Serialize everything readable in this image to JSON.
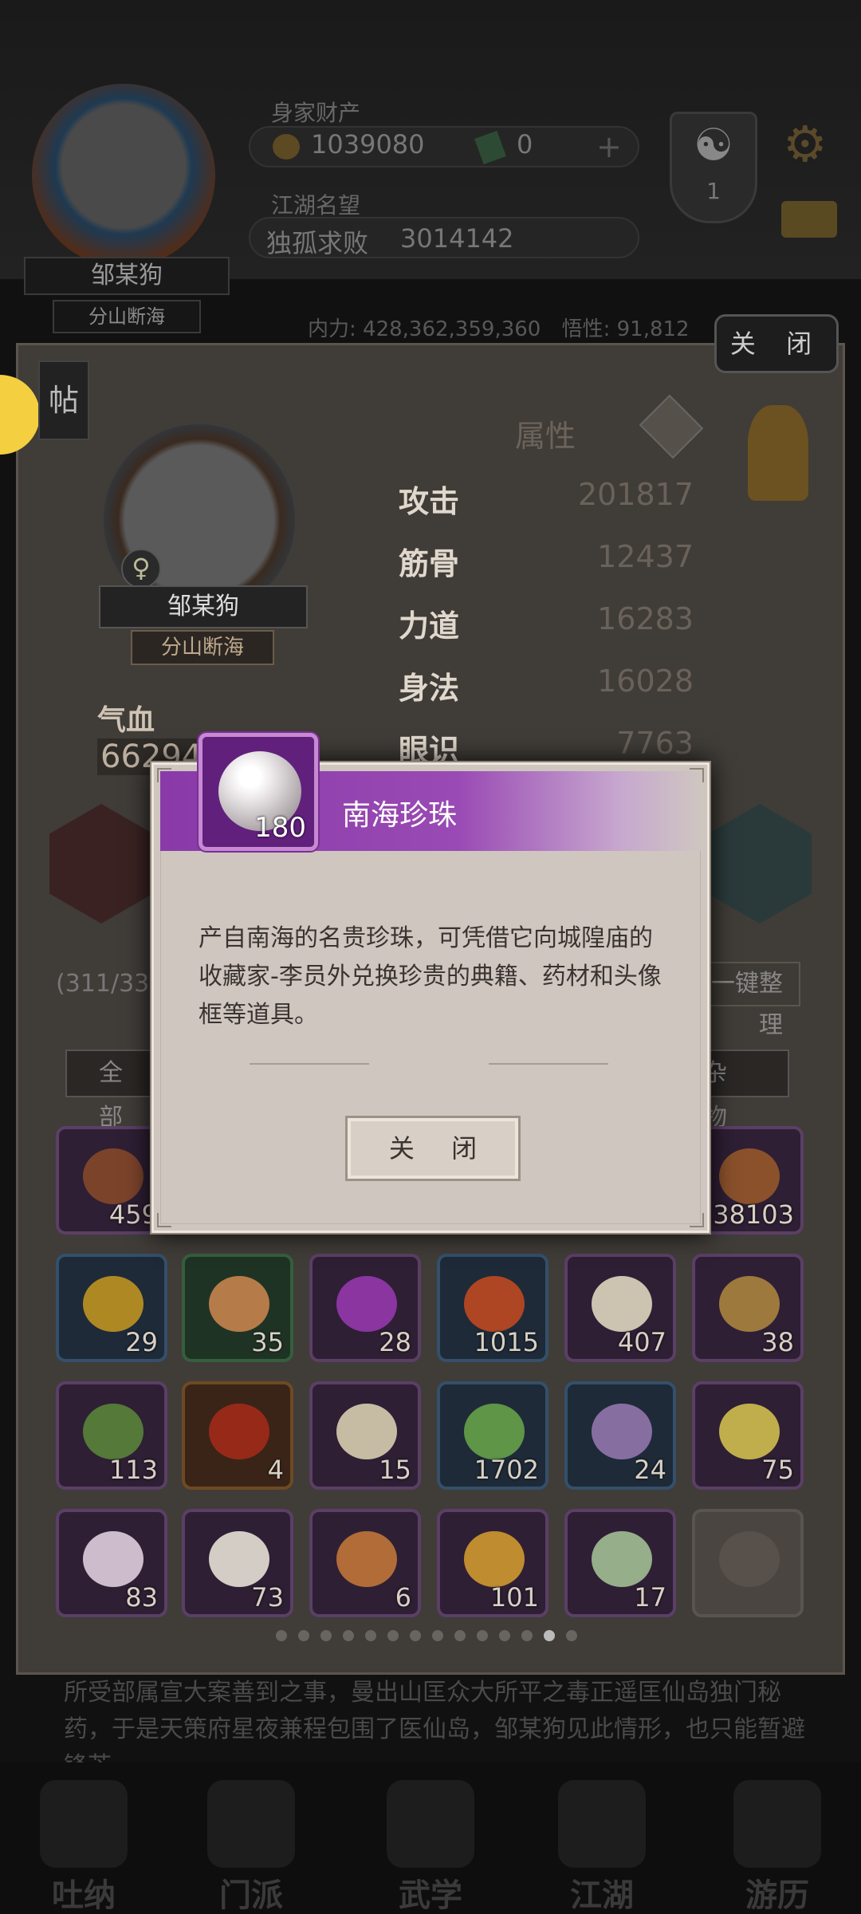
{
  "header": {
    "wealth_label": "身家财产",
    "coins": "1039080",
    "jade": "0",
    "plus": "+",
    "fame_label": "江湖名望",
    "fame_title": "独孤求败",
    "fame_value": "3014142",
    "rank_number": "1",
    "rank_symbol": "☯",
    "player_name": "邹某狗",
    "player_title": "分山断海",
    "power_label": "内力: 428,362,359,360",
    "insight_label": "悟性: 91,812"
  },
  "panel": {
    "close_label": "关 闭",
    "post_label": "帖",
    "gender_symbol": "♀",
    "char_name": "邹某狗",
    "char_title": "分山断海",
    "blood_label": "气血",
    "blood_value": "66294",
    "attr_title": "属性",
    "attributes": [
      {
        "name": "攻击",
        "value": "201817"
      },
      {
        "name": "筋骨",
        "value": "12437"
      },
      {
        "name": "力道",
        "value": "16283"
      },
      {
        "name": "身法",
        "value": "16028"
      },
      {
        "name": "眼识",
        "value": "7763"
      }
    ],
    "bag_count": "(311/336",
    "sort_label": "一键整理",
    "filter_all": "全 部",
    "filter_misc": "杂 物"
  },
  "items": [
    {
      "count": "459",
      "quality": "purple",
      "color": "#8a4a2a"
    },
    {
      "count": "",
      "quality": "purple",
      "color": "#5a4a6a"
    },
    {
      "count": "",
      "quality": "purple",
      "color": "#5a4a6a"
    },
    {
      "count": "",
      "quality": "purple",
      "color": "#5a4a6a"
    },
    {
      "count": "",
      "quality": "purple",
      "color": "#5a4a6a"
    },
    {
      "count": "38103",
      "quality": "purple",
      "color": "#9a5a2a"
    },
    {
      "count": "29",
      "quality": "blue",
      "color": "#c89a20"
    },
    {
      "count": "35",
      "quality": "green",
      "color": "#d08a50"
    },
    {
      "count": "28",
      "quality": "purple",
      "color": "#9a3ab4"
    },
    {
      "count": "1015",
      "quality": "blue",
      "color": "#c84a20"
    },
    {
      "count": "407",
      "quality": "purple",
      "color": "#e8e0c8"
    },
    {
      "count": "38",
      "quality": "purple",
      "color": "#b08a40"
    },
    {
      "count": "113",
      "quality": "purple",
      "color": "#5a8a3a"
    },
    {
      "count": "4",
      "quality": "orange",
      "color": "#a82a1a"
    },
    {
      "count": "15",
      "quality": "purple",
      "color": "#e0d8b8"
    },
    {
      "count": "1702",
      "quality": "blue",
      "color": "#6aa84a"
    },
    {
      "count": "24",
      "quality": "blue",
      "color": "#9a7ab4"
    },
    {
      "count": "75",
      "quality": "purple",
      "color": "#d8c850"
    },
    {
      "count": "83",
      "quality": "purple",
      "color": "#e8d8e8"
    },
    {
      "count": "73",
      "quality": "purple",
      "color": "#f0ece0"
    },
    {
      "count": "6",
      "quality": "purple",
      "color": "#c87a3a"
    },
    {
      "count": "101",
      "quality": "purple",
      "color": "#d8a030"
    },
    {
      "count": "17",
      "quality": "purple",
      "color": "#a8c89a"
    },
    {
      "count": "",
      "quality": "empty",
      "color": "#5a524c"
    }
  ],
  "pagination": {
    "total": 14,
    "active": 12
  },
  "story_text": "所受部属宣大案善到之事，曼出山匡众大所平之毒正遥匡仙岛独门秘药，于是天策府星夜兼程包围了医仙岛，邹某狗见此情形，也只能暂避锋芒……",
  "nav": [
    {
      "label": "吐纳",
      "color": "#3a1a1a"
    },
    {
      "label": "门派",
      "color": "#1a2a3a"
    },
    {
      "label": "武学",
      "color": "#1a2230"
    },
    {
      "label": "江湖",
      "color": "#2a1a1a"
    },
    {
      "label": "游历",
      "color": "#2a2a2a"
    }
  ],
  "dialog": {
    "item_name": "南海珍珠",
    "item_count": "180",
    "item_icon": "pearl-icon",
    "description": "产自南海的名贵珍珠，可凭借它向城隍庙的收藏家-李员外兑换珍贵的典籍、药材和头像框等道具。",
    "close_label": "关 闭",
    "header_color": "#8a3aa8"
  }
}
